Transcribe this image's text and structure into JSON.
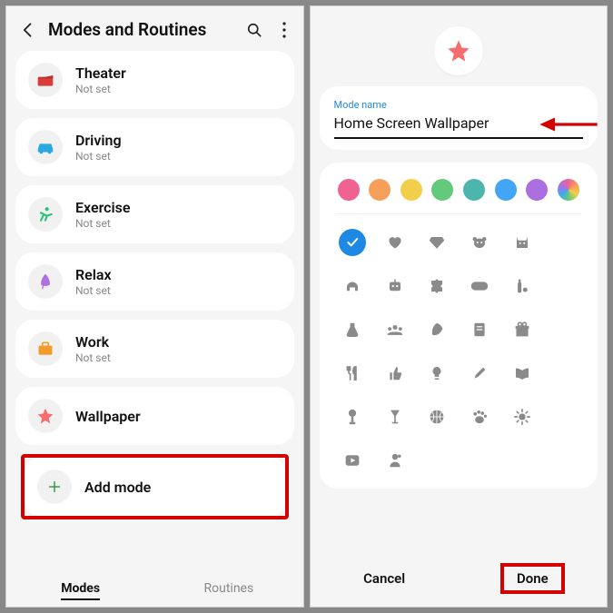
{
  "left": {
    "title": "Modes and Routines",
    "modes": [
      {
        "label": "Theater",
        "status": "Not set",
        "icon": "theater",
        "color": "#d93b3b"
      },
      {
        "label": "Driving",
        "status": "Not set",
        "icon": "car",
        "color": "#2aa8e0"
      },
      {
        "label": "Exercise",
        "status": "Not set",
        "icon": "exercise",
        "color": "#27c17a"
      },
      {
        "label": "Relax",
        "status": "Not set",
        "icon": "feather",
        "color": "#b070e0"
      },
      {
        "label": "Work",
        "status": "Not set",
        "icon": "briefcase",
        "color": "#f29b2a"
      },
      {
        "label": "Wallpaper",
        "status": "",
        "icon": "star",
        "color": "#f76c6c"
      }
    ],
    "add_label": "Add mode",
    "tab_modes": "Modes",
    "tab_routines": "Routines"
  },
  "right": {
    "field_label": "Mode name",
    "field_value": "Home Screen Wallpaper",
    "colors": [
      "#f06292",
      "#f5a05a",
      "#f2cf4a",
      "#63c97b",
      "#4db6ac",
      "#42a5f5",
      "#ab6fe0",
      "rainbow"
    ],
    "icons_grid": [
      [
        "check",
        "heart",
        "diamond",
        "dog",
        "cat",
        "(none)"
      ],
      [
        "headphones",
        "robot",
        "puzzle",
        "controller",
        "bottle",
        "(none)"
      ],
      [
        "flask",
        "group",
        "leaf",
        "note",
        "gift",
        "(none)"
      ],
      [
        "cutlery",
        "thumbsup",
        "bulb",
        "pen",
        "book",
        "(none)"
      ],
      [
        "lamp",
        "glass",
        "basketball",
        "paw",
        "sun",
        "(none)"
      ],
      [
        "play-square",
        "person-generic",
        "",
        "",
        "",
        ""
      ]
    ],
    "cancel": "Cancel",
    "done": "Done"
  }
}
